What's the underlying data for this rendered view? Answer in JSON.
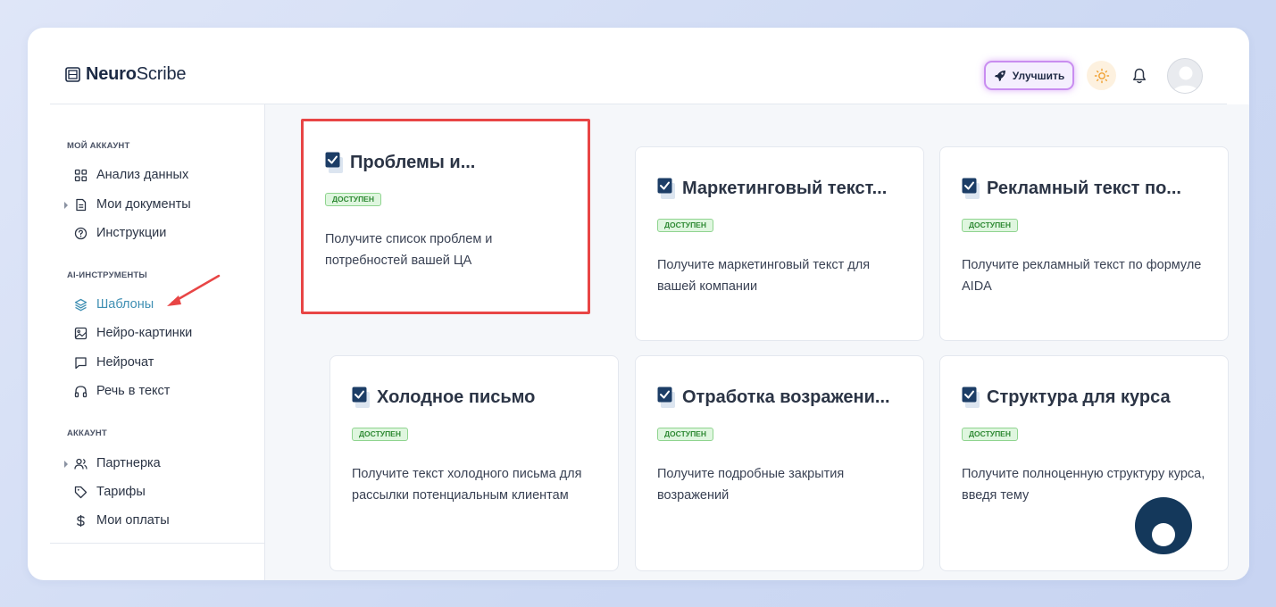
{
  "app": {
    "logo_bold": "Neuro",
    "logo_light": "Scribe"
  },
  "header": {
    "upgrade_label": "Улучшить",
    "icons": [
      "rocket-icon",
      "sun-icon",
      "bell-icon",
      "avatar"
    ]
  },
  "sidebar": {
    "sections": [
      {
        "title": "МОЙ АККАУНТ",
        "items": [
          {
            "label": "Анализ данных",
            "icon": "grid-icon"
          },
          {
            "label": "Мои документы",
            "icon": "document-icon",
            "expandable": true
          },
          {
            "label": "Инструкции",
            "icon": "question-icon"
          }
        ]
      },
      {
        "title": "AI-ИНСТРУМЕНТЫ",
        "items": [
          {
            "label": "Шаблоны",
            "icon": "layers-icon",
            "active": true
          },
          {
            "label": "Нейро-картинки",
            "icon": "image-icon"
          },
          {
            "label": "Нейрочат",
            "icon": "chat-icon"
          },
          {
            "label": "Речь в текст",
            "icon": "headphones-icon"
          }
        ]
      },
      {
        "title": "АККАУНТ",
        "items": [
          {
            "label": "Партнерка",
            "icon": "users-icon",
            "expandable": true
          },
          {
            "label": "Тарифы",
            "icon": "tag-icon"
          },
          {
            "label": "Мои оплаты",
            "icon": "dollar-icon"
          }
        ]
      }
    ]
  },
  "templates": [
    {
      "title": "Проблемы и...",
      "badge": "ДОСТУПЕН",
      "description": "Получите список проблем и потребностей вашей ЦА",
      "highlighted": true
    },
    {
      "title": "Маркетинговый текст...",
      "badge": "ДОСТУПЕН",
      "description": "Получите маркетинговый текст для вашей компании"
    },
    {
      "title": "Рекламный текст по...",
      "badge": "ДОСТУПЕН",
      "description": "Получите рекламный текст по формуле AIDA"
    },
    {
      "title": "Холодное письмо",
      "badge": "ДОСТУПЕН",
      "description": "Получите текст холодного письма для рассылки потенциальным клиентам"
    },
    {
      "title": "Отработка возражени...",
      "badge": "ДОСТУПЕН",
      "description": "Получите подробные закрытия возражений"
    },
    {
      "title": "Структура для курса",
      "badge": "ДОСТУПЕН",
      "description": "Получите полноценную структуру курса, введя тему"
    }
  ],
  "colors": {
    "accent": "#3f8fb3",
    "highlight": "#e84545",
    "badge_bg": "#dff6df",
    "badge_text": "#2f8a34",
    "upgrade_glow": "#c98df0",
    "chat_button": "#14385b"
  }
}
